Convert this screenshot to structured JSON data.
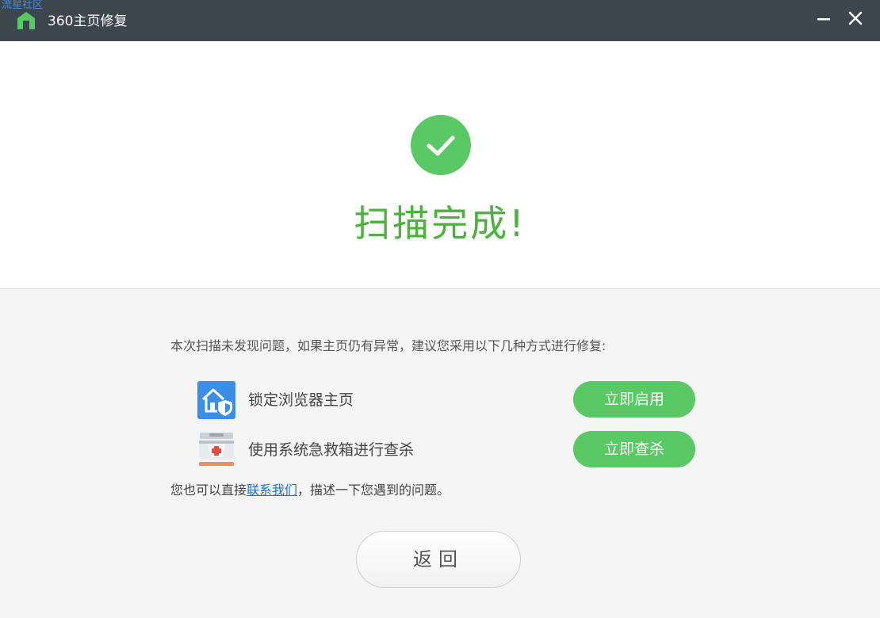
{
  "watermark": "流星社区",
  "window": {
    "title": "360主页修复",
    "minimize_label": "—",
    "close_label": "✕"
  },
  "result": {
    "icon": "check-icon",
    "headline": "扫描完成!"
  },
  "suggestion": {
    "text": "本次扫描未发现问题，如果主页仍有异常，建议您采用以下几种方式进行修复:"
  },
  "options": [
    {
      "icon": "lock-homepage-icon",
      "label": "锁定浏览器主页",
      "button": "立即启用"
    },
    {
      "icon": "first-aid-kit-icon",
      "label": "使用系统急救箱进行查杀",
      "button": "立即查杀"
    }
  ],
  "contact": {
    "prefix": "您也可以直接",
    "link": "联系我们",
    "suffix": "，描述一下您遇到的问题。"
  },
  "back_button": "返回",
  "colors": {
    "titlebar": "#3c464e",
    "success_green": "#4bb23b",
    "button_green": "#5ac864",
    "link_blue": "#1f6fd6",
    "panel_grey": "#f5f5f5"
  }
}
